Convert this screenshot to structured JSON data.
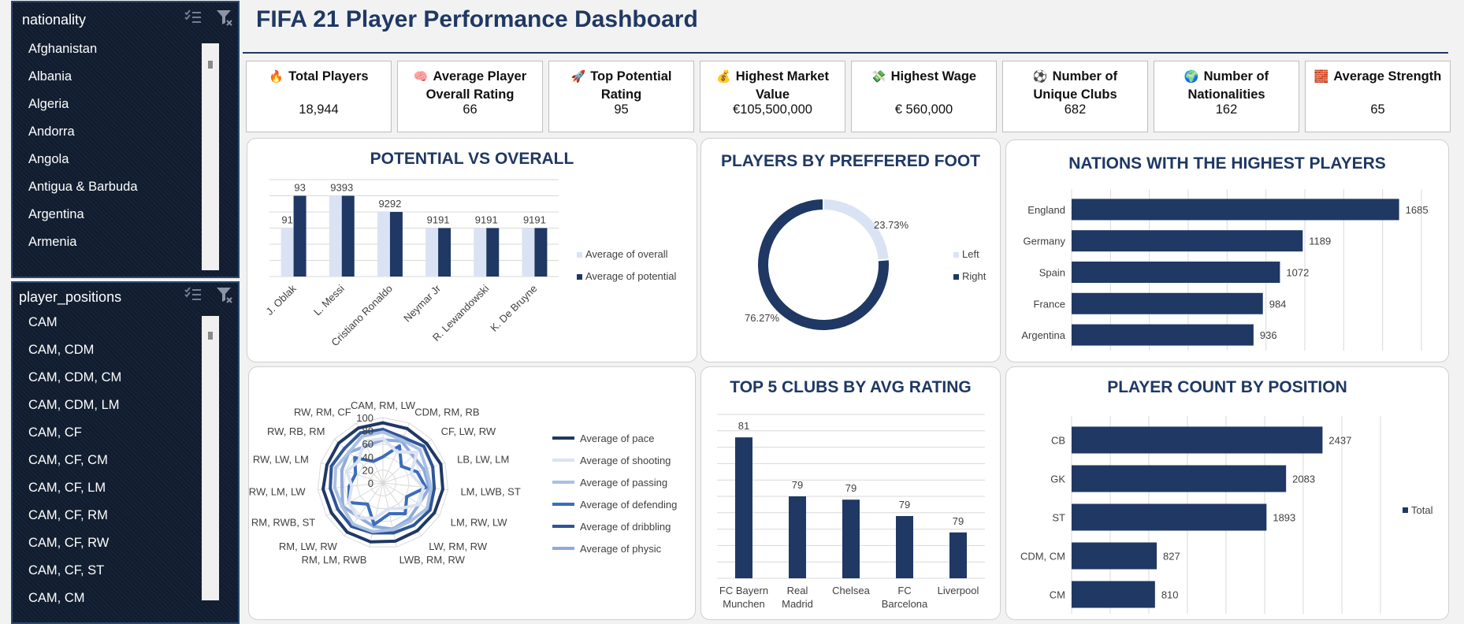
{
  "colors": {
    "navy": "#1f3864",
    "light": "#dae3f3",
    "title": "#1f3864"
  },
  "slicers": [
    {
      "title": "nationality",
      "items": [
        "Afghanistan",
        "Albania",
        "Algeria",
        "Andorra",
        "Angola",
        "Antigua & Barbuda",
        "Argentina",
        "Armenia"
      ]
    },
    {
      "title": "player_positions",
      "items": [
        "CAM",
        "CAM, CDM",
        "CAM, CDM, CM",
        "CAM, CDM, LM",
        "CAM, CF",
        "CAM, CF, CM",
        "CAM, CF, LM",
        "CAM, CF, RM",
        "CAM, CF, RW",
        "CAM, CF, ST",
        "CAM, CM"
      ]
    }
  ],
  "header": {
    "title": "FIFA 21 Player Performance Dashboard"
  },
  "kpis": [
    {
      "icon": "fire-icon",
      "glyph": "🔥",
      "label": "Total Players",
      "value": "18,944"
    },
    {
      "icon": "brain-icon",
      "glyph": "🧠",
      "label": "Average Player Overall Rating",
      "value": "66"
    },
    {
      "icon": "rocket-icon",
      "glyph": "🚀",
      "label": "Top Potential Rating",
      "value": "95"
    },
    {
      "icon": "money-bag-icon",
      "glyph": "💰",
      "label": "Highest Market Value",
      "value": "€105,500,000"
    },
    {
      "icon": "money-wings-icon",
      "glyph": "💸",
      "label": "Highest Wage",
      "value": "€ 560,000"
    },
    {
      "icon": "soccer-ball-icon",
      "glyph": "⚽",
      "label": "Number of Unique Clubs",
      "value": "682"
    },
    {
      "icon": "globe-icon",
      "glyph": "🌍",
      "label": "Number of Nationalities",
      "value": "162"
    },
    {
      "icon": "bricks-icon",
      "glyph": "🧱",
      "label": "Average Strength",
      "value": "65"
    }
  ],
  "chart_data": [
    {
      "id": "potential-vs-overall",
      "type": "bar",
      "title": "POTENTIAL VS OVERALL",
      "categories": [
        "J. Oblak",
        "L. Messi",
        "Cristiano Ronaldo",
        "Neymar Jr",
        "R. Lewandowski",
        "K. De Bruyne"
      ],
      "series": [
        {
          "name": "Average of overall",
          "values": [
            91,
            93,
            92,
            91,
            91,
            91
          ],
          "color": "#dae3f3"
        },
        {
          "name": "Average of potential",
          "values": [
            93,
            93,
            92,
            91,
            91,
            91
          ],
          "color": "#1f3864"
        }
      ],
      "ylim": [
        88,
        94
      ],
      "grid": true,
      "legend": "right"
    },
    {
      "id": "players-by-foot",
      "type": "pie",
      "title": "PLAYERS BY PREFFERED FOOT",
      "labels": [
        "Left",
        "Right"
      ],
      "values": [
        23.73,
        76.27
      ],
      "value_labels": [
        "23.73%",
        "76.27%"
      ],
      "colors": [
        "#dae3f3",
        "#1f3864"
      ],
      "legend": "right"
    },
    {
      "id": "nations-highest-players",
      "type": "bar",
      "title": "NATIONS WITH THE HIGHEST PLAYERS",
      "orientation": "horizontal",
      "categories": [
        "England",
        "Germany",
        "Spain",
        "France",
        "Argentina"
      ],
      "values": [
        1685,
        1189,
        1072,
        984,
        936
      ],
      "xlim": [
        0,
        1800
      ],
      "grid": true
    },
    {
      "id": "attributes-radar",
      "type": "radar",
      "title": "",
      "categories": [
        "CAM, RM, LW",
        "CDM, RM, RB",
        "CF, LW, RW",
        "LB, LW, LM",
        "LM, LWB, ST",
        "LM, RW, LW",
        "LW, RM, RW",
        "LWB, RM, RW",
        "RM, LM, RWB",
        "RM, LW, RW",
        "RM, RWB, ST",
        "RW, LM, LW",
        "RW, LW, LM",
        "RW, RB, RM",
        "RW, RM, CF"
      ],
      "rticks": [
        0,
        20,
        40,
        60,
        80,
        100
      ],
      "rlim": [
        0,
        100
      ],
      "series": [
        {
          "name": "Average of pace",
          "color": "#1f3864",
          "values": [
            92,
            91,
            90,
            93,
            92,
            91,
            90,
            91,
            92,
            93,
            91,
            92,
            90,
            91,
            92
          ]
        },
        {
          "name": "Average of shooting",
          "color": "#dae3f3",
          "values": [
            68,
            52,
            70,
            45,
            62,
            65,
            48,
            40,
            55,
            66,
            60,
            48,
            58,
            50,
            70
          ]
        },
        {
          "name": "Average of passing",
          "color": "#a9c0e2",
          "values": [
            78,
            72,
            76,
            70,
            74,
            78,
            72,
            73,
            76,
            78,
            72,
            74,
            76,
            70,
            78
          ]
        },
        {
          "name": "Average of defending",
          "color": "#3d6cb9",
          "values": [
            40,
            62,
            38,
            55,
            66,
            42,
            58,
            48,
            65,
            40,
            60,
            52,
            44,
            58,
            36
          ]
        },
        {
          "name": "Average of dribbling",
          "color": "#2f5597",
          "values": [
            82,
            76,
            84,
            80,
            79,
            83,
            80,
            78,
            78,
            82,
            80,
            81,
            83,
            79,
            84
          ]
        },
        {
          "name": "Average of physic",
          "color": "#8faadc",
          "values": [
            66,
            70,
            62,
            66,
            71,
            64,
            68,
            72,
            68,
            64,
            71,
            63,
            66,
            70,
            62
          ]
        }
      ],
      "legend": "right"
    },
    {
      "id": "top-clubs-rating",
      "type": "bar",
      "title": "TOP 5 CLUBS BY AVG RATING",
      "categories": [
        "FC Bayern Munchen",
        "Real Madrid",
        "Chelsea",
        "FC Barcelona",
        "Liverpool"
      ],
      "values": [
        81,
        79,
        79,
        79,
        79
      ],
      "plotted_values": [
        80.8,
        79.0,
        78.9,
        78.4,
        77.9
      ],
      "ylim": [
        76.5,
        81.5
      ],
      "grid": true
    },
    {
      "id": "player-count-position",
      "type": "bar",
      "title": "PLAYER COUNT BY POSITION",
      "orientation": "horizontal",
      "categories": [
        "CB",
        "GK",
        "ST",
        "CDM, CM",
        "CM"
      ],
      "values": [
        2437,
        2083,
        1893,
        827,
        810
      ],
      "series_name": "Total",
      "xlim": [
        0,
        3000
      ],
      "grid": true,
      "legend": "right"
    }
  ]
}
